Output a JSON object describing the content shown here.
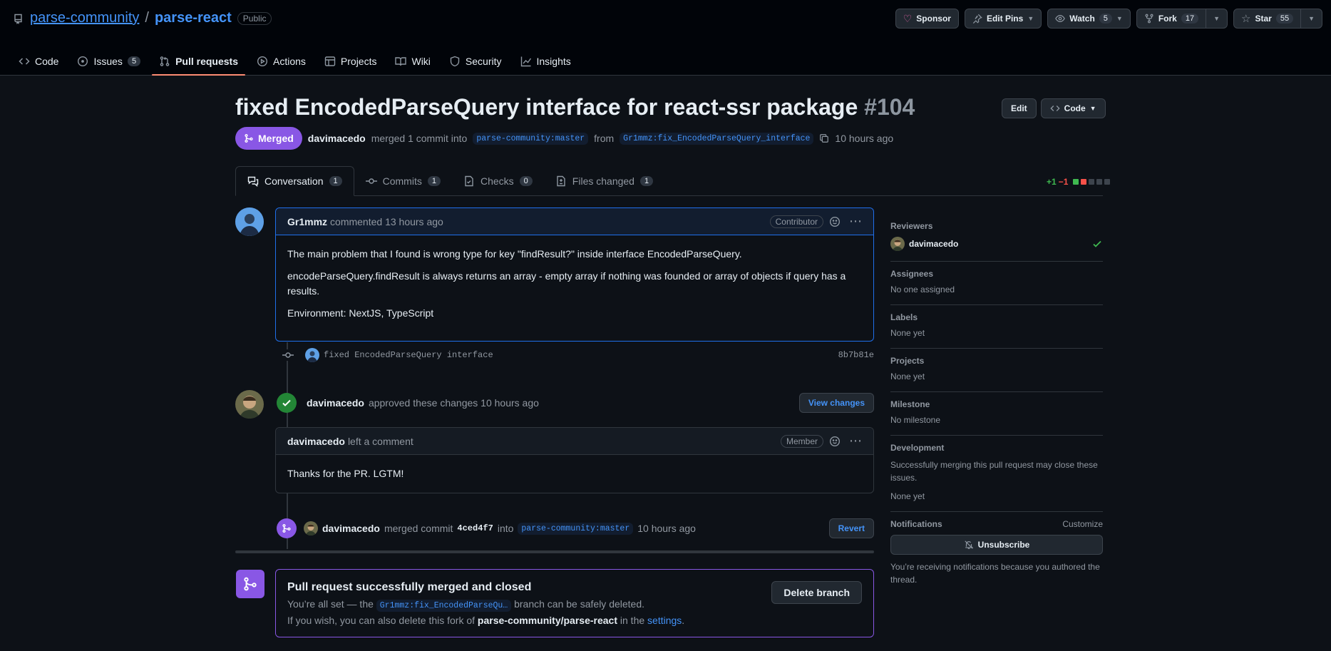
{
  "repo": {
    "owner": "parse-community",
    "name": "parse-react",
    "visibility": "Public"
  },
  "header_buttons": {
    "sponsor": "Sponsor",
    "edit_pins": "Edit Pins",
    "watch": "Watch",
    "watch_count": "5",
    "fork": "Fork",
    "fork_count": "17",
    "star": "Star",
    "star_count": "55"
  },
  "nav": [
    {
      "label": "Code"
    },
    {
      "label": "Issues",
      "count": "5"
    },
    {
      "label": "Pull requests"
    },
    {
      "label": "Actions"
    },
    {
      "label": "Projects"
    },
    {
      "label": "Wiki"
    },
    {
      "label": "Security"
    },
    {
      "label": "Insights"
    }
  ],
  "pr": {
    "title": "fixed EncodedParseQuery interface for react-ssr package",
    "number": "#104",
    "edit_label": "Edit",
    "code_label": "Code",
    "state": "Merged",
    "author": "davimacedo",
    "meta_text": "merged 1 commit into",
    "base_branch": "parse-community:master",
    "from_text": "from",
    "head_branch": "Gr1mmz:fix_EncodedParseQuery_interface",
    "time": "10 hours ago"
  },
  "pr_tabs": [
    {
      "label": "Conversation",
      "count": "1"
    },
    {
      "label": "Commits",
      "count": "1"
    },
    {
      "label": "Checks",
      "count": "0"
    },
    {
      "label": "Files changed",
      "count": "1"
    }
  ],
  "diffstat": {
    "add": "+1",
    "del": "−1"
  },
  "comment1": {
    "author": "Gr1mmz",
    "action": "commented 13 hours ago",
    "role": "Contributor",
    "body": [
      "The main problem that I found is wrong type for key \"findResult?\" inside interface EncodedParseQuery.",
      "encodeParseQuery.findResult is always returns an array - empty array if nothing was founded or array of objects if query has a results.",
      "Environment: NextJS, TypeScript"
    ]
  },
  "commit": {
    "message": "fixed EncodedParseQuery interface",
    "sha": "8b7b81e"
  },
  "review": {
    "author": "davimacedo",
    "action": "approved these changes 10 hours ago",
    "view_changes": "View changes"
  },
  "comment2": {
    "author": "davimacedo",
    "action": "left a comment",
    "role": "Member",
    "body": "Thanks for the PR. LGTM!"
  },
  "merge_event": {
    "author": "davimacedo",
    "text1": "merged commit",
    "sha": "4ced4f7",
    "text2": "into",
    "branch": "parse-community:master",
    "time": "10 hours ago",
    "revert": "Revert"
  },
  "merge_box": {
    "title": "Pull request successfully merged and closed",
    "line1_pre": "You’re all set — the",
    "line1_branch": "Gr1mmz:fix_EncodedParseQu…",
    "line1_post": "branch can be safely deleted.",
    "line2_pre": "If you wish, you can also delete this fork of",
    "line2_repo": "parse-community/parse-react",
    "line2_mid": "in the",
    "line2_link": "settings",
    "line2_end": ".",
    "delete_button": "Delete branch"
  },
  "sidebar": {
    "reviewers_title": "Reviewers",
    "reviewer": "davimacedo",
    "assignees_title": "Assignees",
    "assignees_value": "No one assigned",
    "labels_title": "Labels",
    "labels_value": "None yet",
    "projects_title": "Projects",
    "projects_value": "None yet",
    "milestone_title": "Milestone",
    "milestone_value": "No milestone",
    "development_title": "Development",
    "development_desc": "Successfully merging this pull request may close these issues.",
    "development_value": "None yet",
    "notifications_title": "Notifications",
    "customize": "Customize",
    "unsubscribe": "Unsubscribe",
    "notif_desc": "You’re receiving notifications because you authored the thread."
  },
  "colors": {
    "merged": "#8957e5",
    "accent": "#4493f8",
    "success": "#238636",
    "tab_underline": "#fd8c73"
  }
}
